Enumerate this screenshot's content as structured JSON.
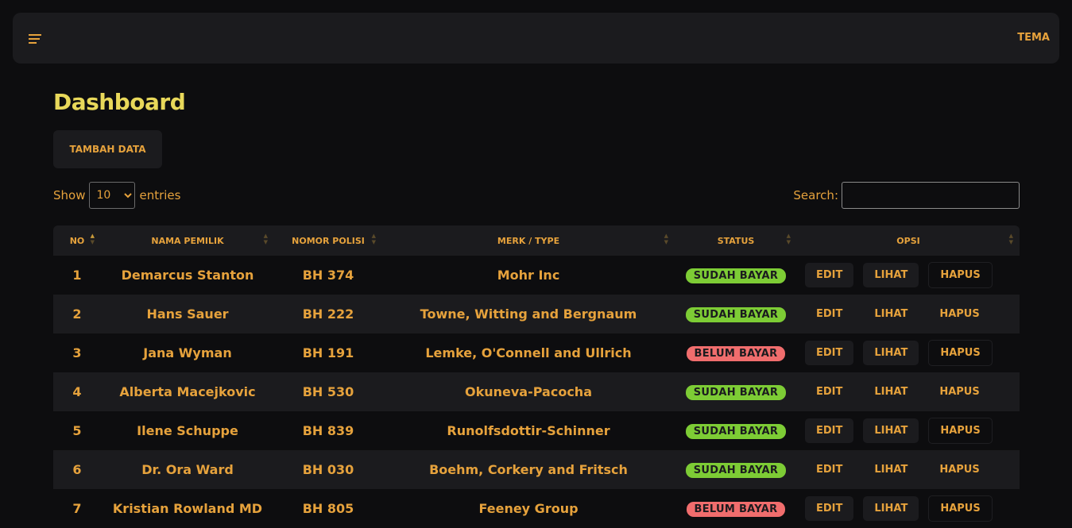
{
  "navbar": {
    "menu_icon": "menu-lines-icon",
    "theme_label": "TEMA"
  },
  "page": {
    "title": "Dashboard",
    "add_button_label": "TAMBAH DATA"
  },
  "table_controls": {
    "show_label": "Show",
    "entries_label": "entries",
    "page_length_options": [
      "10"
    ],
    "page_length_selected": "10",
    "search_label": "Search:",
    "search_value": ""
  },
  "table": {
    "columns": [
      "NO",
      "NAMA PEMILIK",
      "NOMOR POLISI",
      "MERK / TYPE",
      "STATUS",
      "OPSI"
    ],
    "action_labels": {
      "edit": "EDIT",
      "view": "LIHAT",
      "delete": "HAPUS"
    },
    "rows": [
      {
        "no": "1",
        "owner": "Demarcus Stanton",
        "plate": "BH 374",
        "brand": "Mohr Inc",
        "status": "SUDAH BAYAR",
        "paid": true
      },
      {
        "no": "2",
        "owner": "Hans Sauer",
        "plate": "BH 222",
        "brand": "Towne, Witting and Bergnaum",
        "status": "SUDAH BAYAR",
        "paid": true
      },
      {
        "no": "3",
        "owner": "Jana Wyman",
        "plate": "BH 191",
        "brand": "Lemke, O'Connell and Ullrich",
        "status": "BELUM BAYAR",
        "paid": false
      },
      {
        "no": "4",
        "owner": "Alberta Macejkovic",
        "plate": "BH 530",
        "brand": "Okuneva-Pacocha",
        "status": "SUDAH BAYAR",
        "paid": true
      },
      {
        "no": "5",
        "owner": "Ilene Schuppe",
        "plate": "BH 839",
        "brand": "Runolfsdottir-Schinner",
        "status": "SUDAH BAYAR",
        "paid": true
      },
      {
        "no": "6",
        "owner": "Dr. Ora Ward",
        "plate": "BH 030",
        "brand": "Boehm, Corkery and Fritsch",
        "status": "SUDAH BAYAR",
        "paid": true
      },
      {
        "no": "7",
        "owner": "Kristian Rowland MD",
        "plate": "BH 805",
        "brand": "Feeney Group",
        "status": "BELUM BAYAR",
        "paid": false
      }
    ]
  },
  "colors": {
    "accent": "#e6a23c",
    "title": "#e8d85a",
    "paid": "#7dcc35",
    "unpaid": "#f06d6d",
    "background": "#0d0d0f",
    "panel": "#1b1b1e"
  }
}
